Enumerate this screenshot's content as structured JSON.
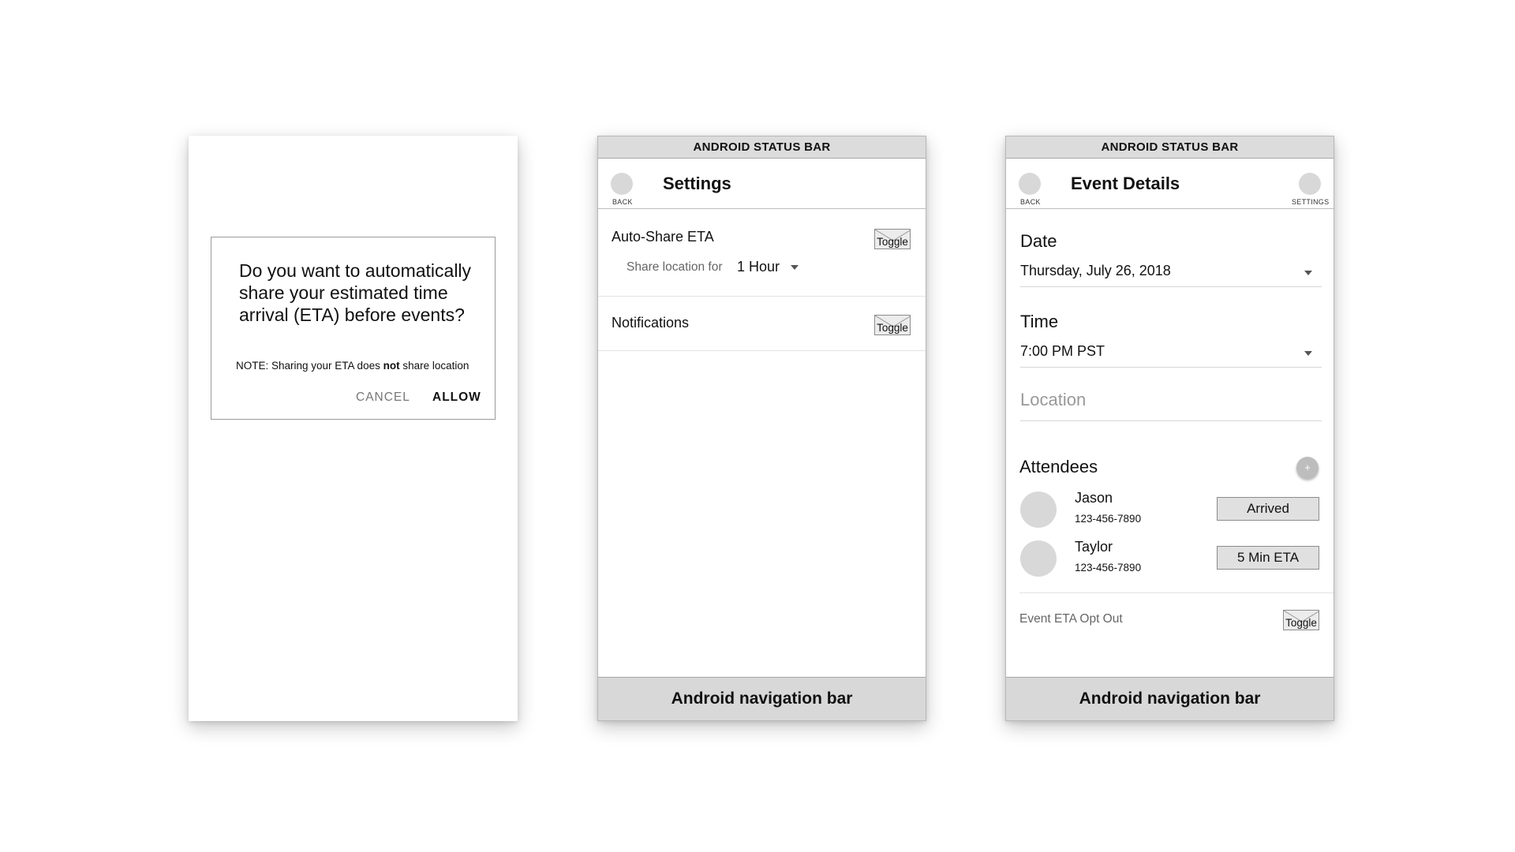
{
  "dialog": {
    "message": "Do you want to automatically share your estimated time arrival (ETA) before events?",
    "note_prefix": "NOTE: Sharing your ETA does ",
    "note_emphasis": "not",
    "note_suffix": " share location",
    "cancel_label": "CANCEL",
    "allow_label": "ALLOW"
  },
  "settings_screen": {
    "status_bar": "ANDROID STATUS BAR",
    "back_caption": "BACK",
    "title": "Settings",
    "auto_share": {
      "label": "Auto-Share ETA",
      "toggle_label": "Toggle",
      "share_for_label": "Share location for",
      "share_for_value": "1 Hour"
    },
    "notifications": {
      "label": "Notifications",
      "toggle_label": "Toggle"
    },
    "nav_bar": "Android navigation bar"
  },
  "event_screen": {
    "status_bar": "ANDROID STATUS BAR",
    "back_caption": "BACK",
    "settings_caption": "SETTINGS",
    "title": "Event Details",
    "date_label": "Date",
    "date_value": "Thursday, July 26, 2018",
    "time_label": "Time",
    "time_value": "7:00 PM PST",
    "location_placeholder": "Location",
    "attendees_label": "Attendees",
    "add_label": "+",
    "attendees": [
      {
        "name": "Jason",
        "phone": "123-456-7890",
        "status": "Arrived"
      },
      {
        "name": "Taylor",
        "phone": "123-456-7890",
        "status": "5 Min ETA"
      }
    ],
    "opt_out_label": "Event ETA Opt Out",
    "opt_out_toggle": "Toggle",
    "nav_bar": "Android navigation bar"
  }
}
